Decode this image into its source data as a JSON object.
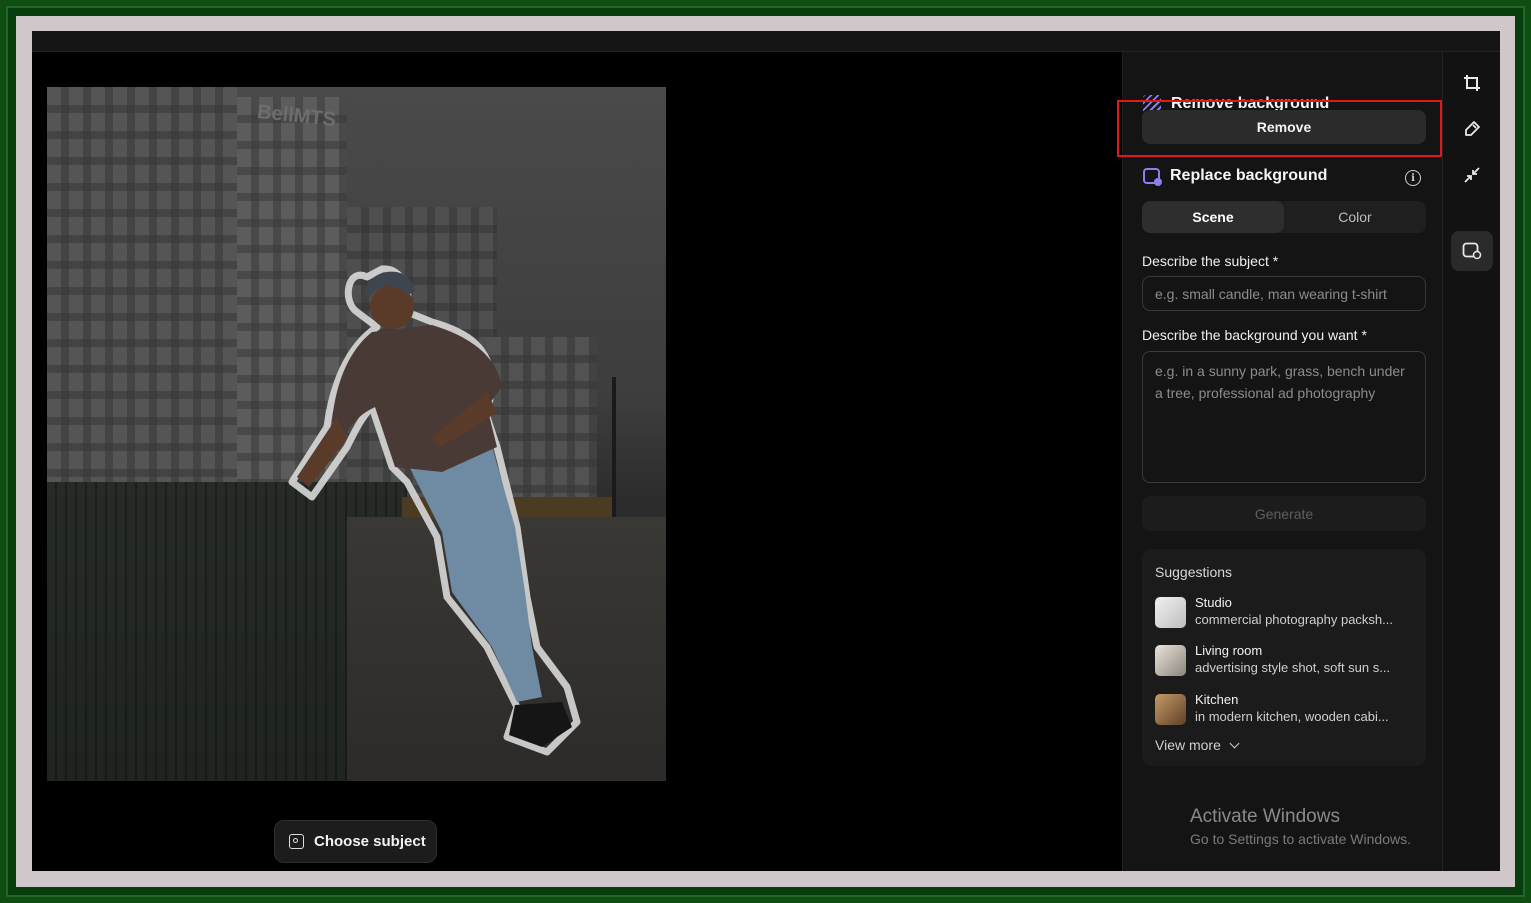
{
  "canvas": {
    "choose_subject_label": "Choose subject",
    "building_sign": "BellMTS"
  },
  "panel": {
    "remove_section": {
      "title": "Remove background",
      "button_label": "Remove"
    },
    "replace_section": {
      "title": "Replace background",
      "tabs": [
        {
          "label": "Scene",
          "active": true
        },
        {
          "label": "Color",
          "active": false
        }
      ],
      "subject_label": "Describe the subject *",
      "subject_placeholder": "e.g. small candle, man wearing t-shirt",
      "background_label": "Describe the background you want *",
      "background_placeholder": "e.g. in a sunny park, grass, bench under a tree, professional ad photography",
      "generate_label": "Generate"
    },
    "suggestions": {
      "title": "Suggestions",
      "items": [
        {
          "name": "Studio",
          "description": "commercial photography packsh..."
        },
        {
          "name": "Living room",
          "description": "advertising style shot, soft sun s..."
        },
        {
          "name": "Kitchen",
          "description": "in modern kitchen, wooden cabi..."
        }
      ],
      "view_more_label": "View more"
    }
  },
  "rail": {
    "tools": [
      "crop-icon",
      "brush-icon",
      "collapse-icon",
      "replace-background-icon"
    ]
  },
  "overlay": {
    "activate_title": "Activate Windows",
    "activate_subtitle": "Go to Settings to activate Windows."
  },
  "colors": {
    "accent": "#8b7ff2",
    "highlight_border": "#e01818",
    "panel_bg": "#141414",
    "canvas_bg": "#000000"
  }
}
